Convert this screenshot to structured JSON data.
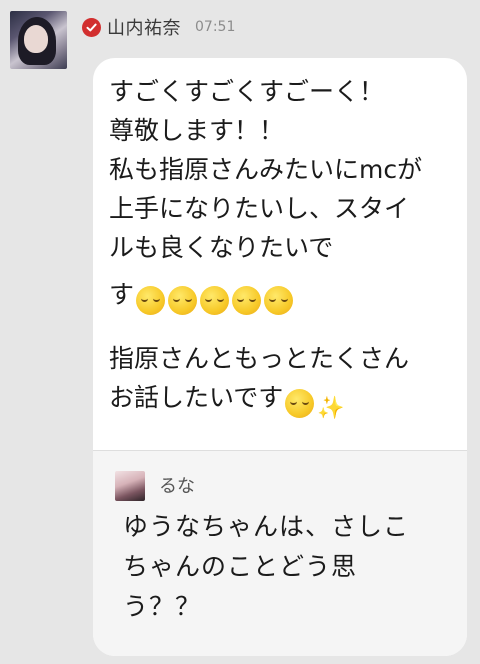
{
  "post": {
    "author": {
      "name": "山内祐奈",
      "verified_icon": "verified-check-icon",
      "verified_color": "#d22f2f"
    },
    "time": "07:51",
    "message": {
      "line1": "すごくすごくすごーく！",
      "line2": "尊敬します！！",
      "line3": "私も指原さんみたいにmcが",
      "line4": "上手になりたいし、スタイ",
      "line5": "ルも良くなりたいで",
      "line6": "す",
      "line6_emojis": [
        "smiling-face-icon",
        "smiling-face-icon",
        "smiling-face-icon",
        "smiling-face-icon",
        "smiling-face-icon"
      ],
      "line7": "指原さんともっとたくさん",
      "line8": "お話したいです",
      "line8_emojis": [
        "grinning-face-icon",
        "sparkles-icon"
      ],
      "sparkle_glyph": "✨"
    },
    "reply": {
      "author": "るな",
      "line1": "ゆうなちゃんは、さしこ",
      "line2": "ちゃんのことどう思",
      "line3": "う？？"
    }
  },
  "colors": {
    "background": "#e6e6e6",
    "bubble": "#ffffff",
    "quote_background": "#f5f5f5"
  }
}
